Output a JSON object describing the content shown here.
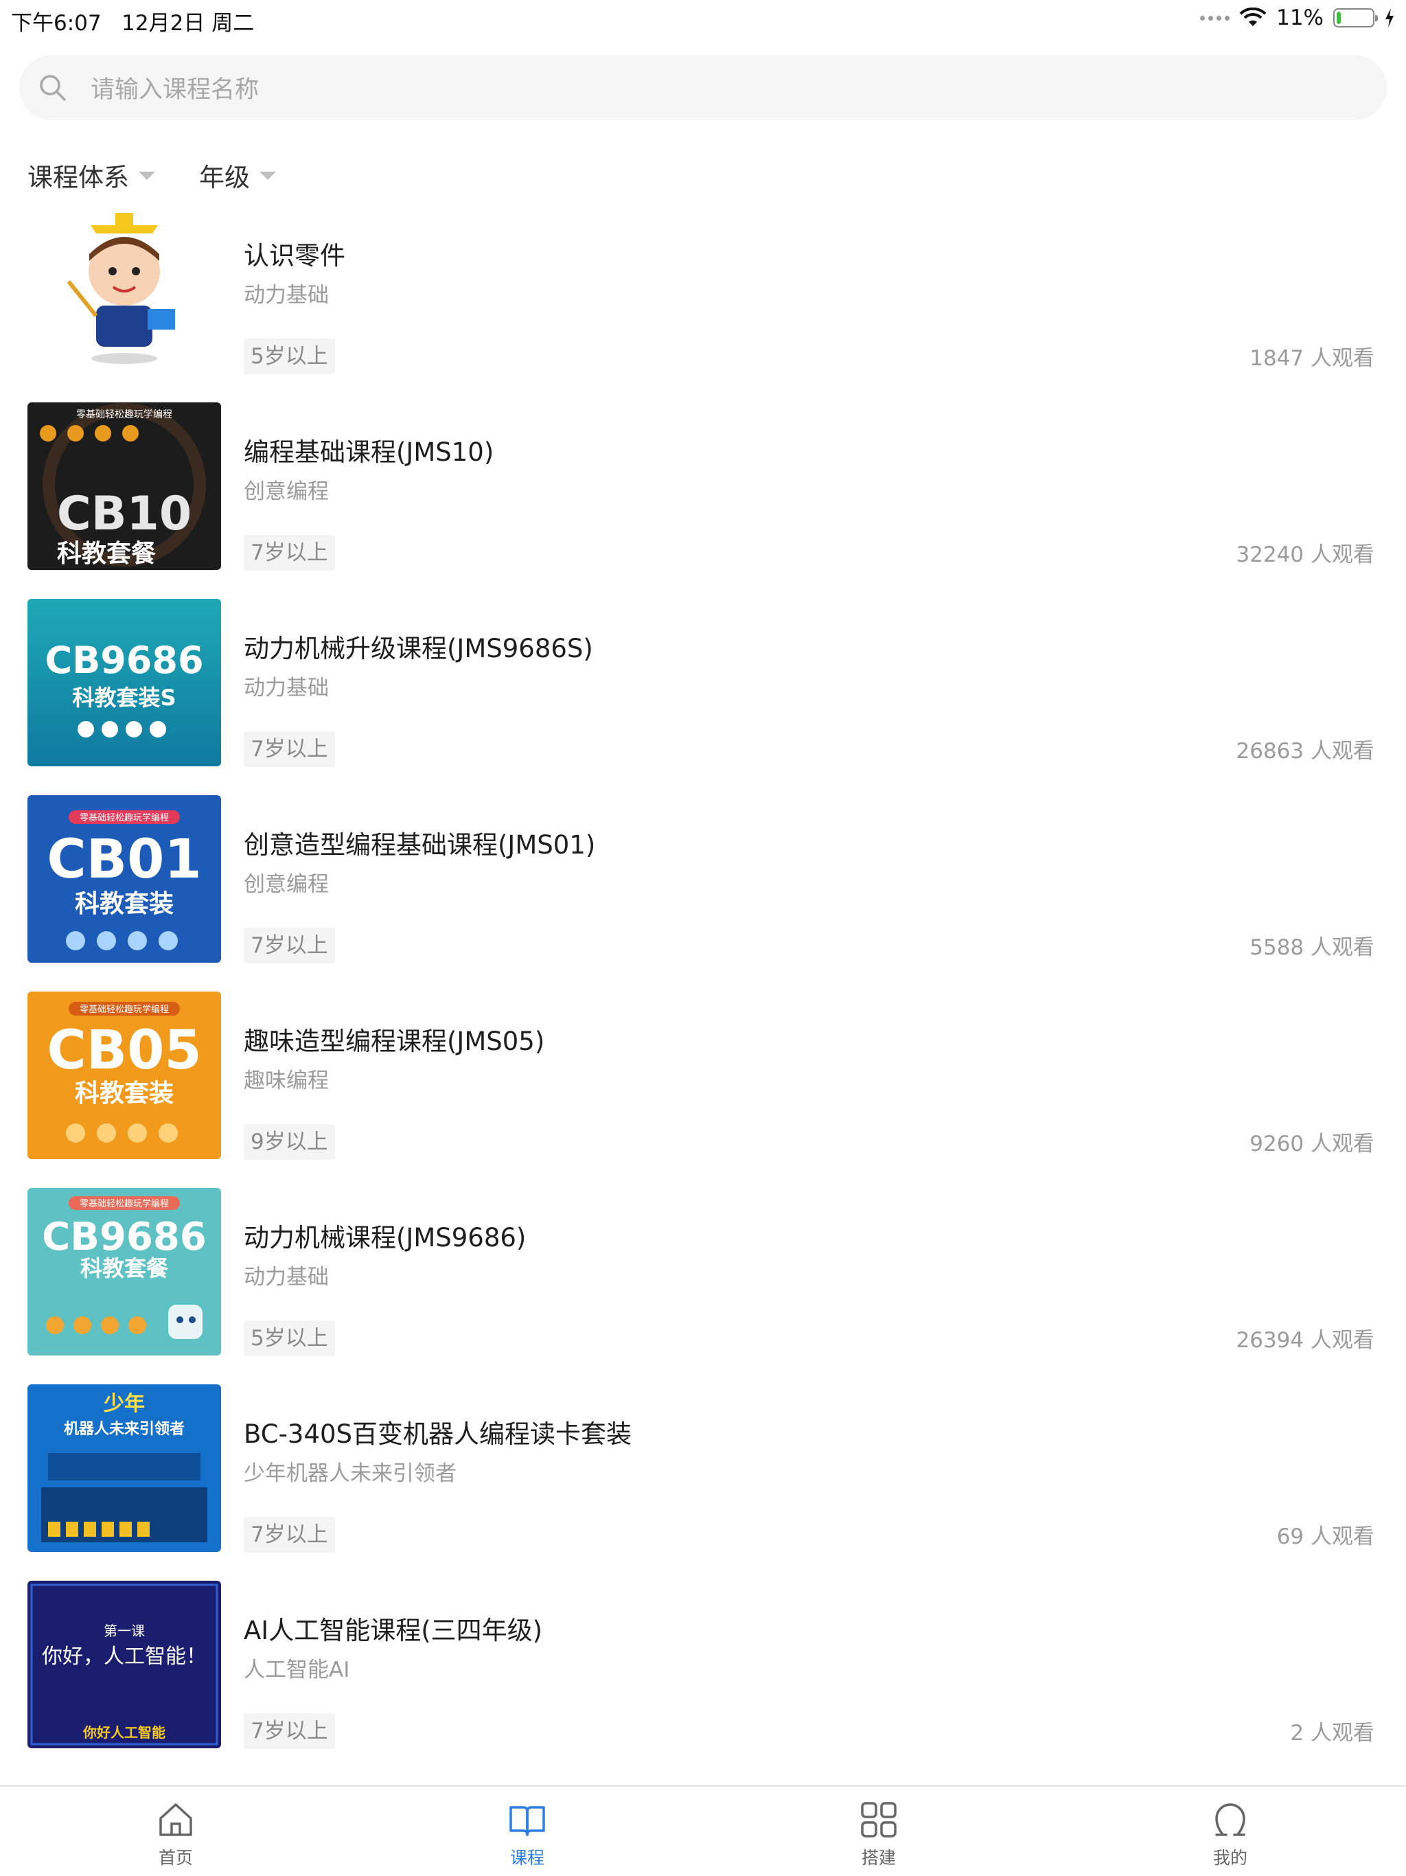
{
  "status": {
    "time_date": "下午6:07   12月2日 周二",
    "battery": "11%",
    "battery_level": 0.11,
    "battery_color": "#3dc13c"
  },
  "search": {
    "placeholder": "请输入课程名称"
  },
  "filters": [
    {
      "label": "课程体系"
    },
    {
      "label": "年级"
    }
  ],
  "courses": [
    {
      "title": "认识零件",
      "category": "动力基础",
      "age": "5岁以上",
      "views": "1847 人观看",
      "thumb_text": ""
    },
    {
      "title": "编程基础课程(JMS10)",
      "category": "创意编程",
      "age": "7岁以上",
      "views": "32240 人观看",
      "thumb_text": "CB10",
      "thumb_sub": "科教套餐",
      "thumb_banner": "零基础轻松趣玩学编程"
    },
    {
      "title": "动力机械升级课程(JMS9686S)",
      "category": "动力基础",
      "age": "7岁以上",
      "views": "26863 人观看",
      "thumb_text": "CB9686",
      "thumb_sub": "科教套装S"
    },
    {
      "title": "创意造型编程基础课程(JMS01)",
      "category": "创意编程",
      "age": "7岁以上",
      "views": "5588 人观看",
      "thumb_text": "CB01",
      "thumb_sub": "科教套装",
      "thumb_banner": "零基础轻松趣玩学编程"
    },
    {
      "title": "趣味造型编程课程(JMS05)",
      "category": "趣味编程",
      "age": "9岁以上",
      "views": "9260 人观看",
      "thumb_text": "CB05",
      "thumb_sub": "科教套装",
      "thumb_banner": "零基础轻松趣玩学编程"
    },
    {
      "title": "动力机械课程(JMS9686)",
      "category": "动力基础",
      "age": "5岁以上",
      "views": "26394 人观看",
      "thumb_text": "CB9686",
      "thumb_sub": "科教套餐",
      "thumb_banner": "零基础轻松趣玩学编程"
    },
    {
      "title": "BC-340S百变机器人编程读卡套装",
      "category": "少年机器人未来引领者",
      "age": "7岁以上",
      "views": "69 人观看",
      "thumb_text": "少年",
      "thumb_sub": "机器人未来引领者"
    },
    {
      "title": "AI人工智能课程(三四年级)",
      "category": "人工智能AI",
      "age": "7岁以上",
      "views": "2 人观看",
      "thumb_text": "你好，人工智能！",
      "thumb_sub": "你好人工智能",
      "thumb_banner": "第一课"
    }
  ],
  "tabbar": [
    {
      "label": "首页",
      "icon": "home-icon"
    },
    {
      "label": "课程",
      "icon": "book-icon",
      "active": true
    },
    {
      "label": "搭建",
      "icon": "grid-icon"
    },
    {
      "label": "我的",
      "icon": "user-icon"
    }
  ],
  "colors": {
    "accent": "#2c7fe6",
    "inactive": "#666666"
  }
}
